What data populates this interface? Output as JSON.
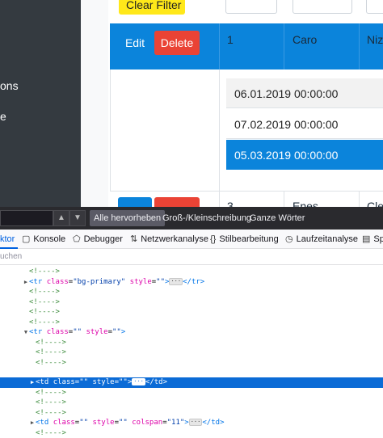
{
  "sidebar": {
    "items": [
      "ons",
      "e"
    ]
  },
  "table": {
    "filter_button": "Clear Filter",
    "row1": {
      "edit": "Edit",
      "delete": "Delete",
      "id": "1",
      "name": "Caro",
      "col3": "Niz"
    },
    "sub_rows": [
      "06.01.2019 00:00:00",
      "07.02.2019 00:00:00",
      "05.03.2019 00:00:00"
    ],
    "row3": {
      "id": "3",
      "name": "Enes",
      "col3": "Cle"
    }
  },
  "devtools": {
    "search_buttons": {
      "highlight_all": "Alle hervorheben",
      "match_case": "Groß-/Kleinschreibung",
      "whole_words": "Ganze Wörter"
    },
    "tabs": [
      "ktor",
      "Konsole",
      "Debugger",
      "Netzwerkanalyse",
      "Stilbearbeitung",
      "Laufzeitanalyse",
      "Sp"
    ],
    "filter_placeholder": "uchen",
    "markup": {
      "comment": "<!---->",
      "tr_primary_tag": "tr",
      "attr_class": "class",
      "attr_style": "style",
      "bg_primary": "\"bg-primary\"",
      "empty_val": "\"\"",
      "td_tag": "td",
      "attr_colspan": "colspan",
      "colspan_val": "\"11\"",
      "ellipsis": "···"
    }
  }
}
